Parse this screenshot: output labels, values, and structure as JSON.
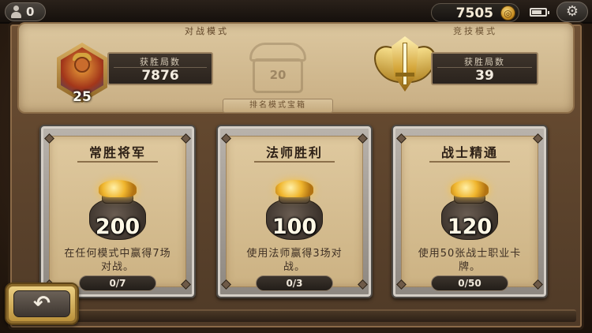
{
  "topbar": {
    "friends_count": "0",
    "gold": "7505",
    "icons": [
      "person-icon",
      "gold-coin-icon",
      "battery-icon",
      "gear-icon"
    ]
  },
  "casual": {
    "title": "对战模式",
    "wins_label": "获胜局数",
    "wins_value": "7876",
    "rank": "25"
  },
  "chest": {
    "number": "20",
    "label": "排名模式宝箱"
  },
  "ranked": {
    "title": "竞技模式",
    "wins_label": "获胜局数",
    "wins_value": "39"
  },
  "quests": [
    {
      "title": "常胜将军",
      "reward": "200",
      "desc": "在任何模式中赢得7场对战。",
      "progress": "0/7",
      "progress_fraction": 0
    },
    {
      "title": "法师胜利",
      "reward": "100",
      "desc": "使用法师赢得3场对战。",
      "progress": "0/3",
      "progress_fraction": 0
    },
    {
      "title": "战士精通",
      "reward": "120",
      "desc": "使用50张战士职业卡牌。",
      "progress": "0/50",
      "progress_fraction": 0
    }
  ],
  "back_button": {
    "icon": "back-arrow-icon"
  },
  "colors": {
    "gold": "#f0b62e",
    "parchment": "#dfc99f",
    "frame": "#6d4f33"
  }
}
